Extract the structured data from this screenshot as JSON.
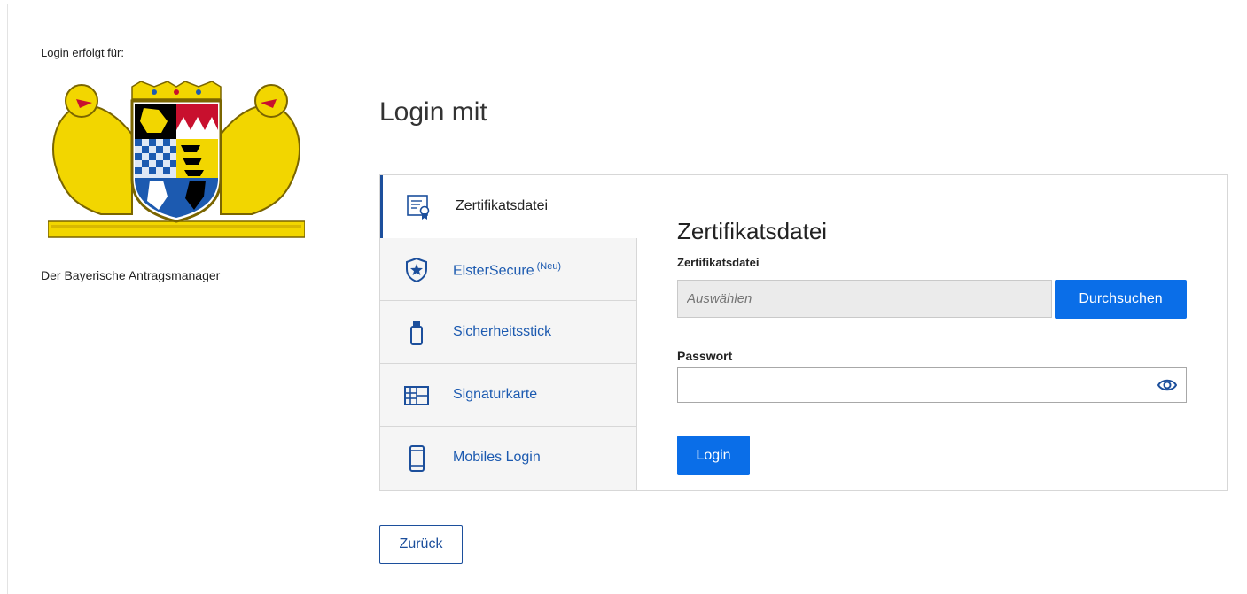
{
  "sidebar": {
    "login_for_label": "Login erfolgt für:",
    "client_name": "Der Bayerische Antragsmanager",
    "logo_icon": "bavarian-coat-of-arms-icon"
  },
  "main": {
    "title": "Login mit",
    "tabs": [
      {
        "label": "Zertifikatsdatei",
        "sup": "",
        "icon": "certificate-icon",
        "active": true
      },
      {
        "label": "ElsterSecure",
        "sup": "(Neu)",
        "icon": "shield-star-icon",
        "active": false
      },
      {
        "label": "Sicherheitsstick",
        "sup": "",
        "icon": "usb-stick-icon",
        "active": false
      },
      {
        "label": "Signaturkarte",
        "sup": "",
        "icon": "smartcard-icon",
        "active": false
      },
      {
        "label": "Mobiles Login",
        "sup": "",
        "icon": "smartphone-icon",
        "active": false
      }
    ],
    "form": {
      "title": "Zertifikatsdatei",
      "file_label": "Zertifikatsdatei",
      "file_placeholder": "Auswählen",
      "browse_label": "Durchsuchen",
      "password_label": "Passwort",
      "password_value": "",
      "eye_icon": "eye-icon",
      "login_label": "Login"
    },
    "back_label": "Zurück"
  },
  "colors": {
    "primary": "#0a6ee8",
    "link": "#1c5ab0",
    "active_border": "#1c4f9c"
  }
}
